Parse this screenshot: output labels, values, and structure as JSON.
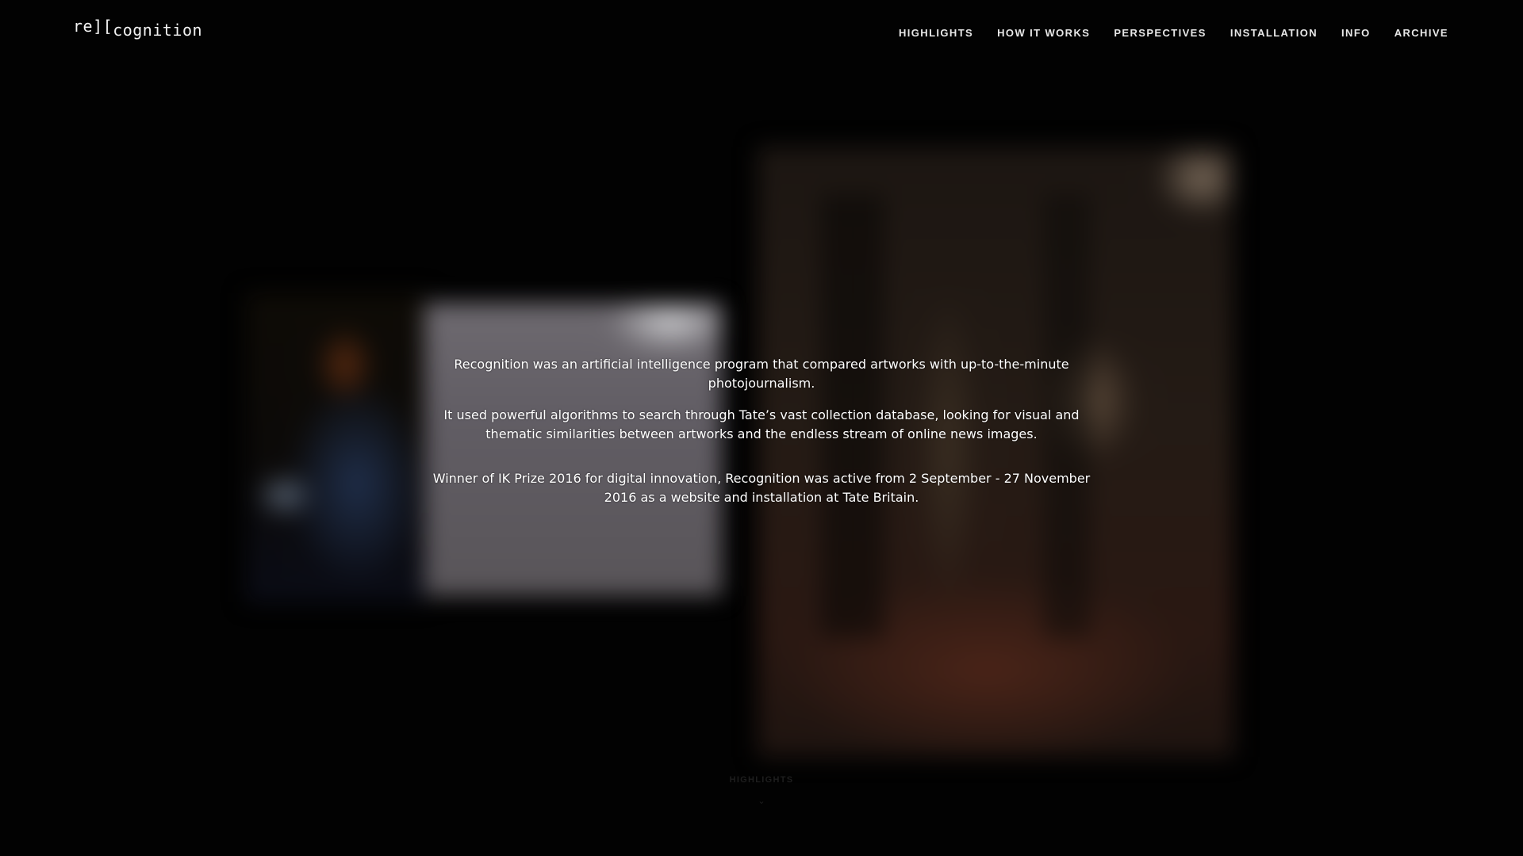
{
  "header": {
    "logo_prefix": "re",
    "logo_bracket": "][",
    "logo_suffix": "cognition",
    "nav": [
      {
        "label": "HIGHLIGHTS"
      },
      {
        "label": "HOW IT WORKS"
      },
      {
        "label": "PERSPECTIVES"
      },
      {
        "label": "INSTALLATION"
      },
      {
        "label": "INFO"
      },
      {
        "label": "ARCHIVE"
      }
    ]
  },
  "intro": {
    "p1": "Recognition was an artificial intelligence program that compared artworks with up-to-the-minute photojournalism.",
    "p2": "It used powerful algorithms to search through Tate’s vast collection database, looking for visual and thematic similarities between artworks and the endless stream of online news images.",
    "p3": "Winner of IK Prize 2016 for digital innovation, Recognition was active from 2 September - 27 November 2016 as a website and installation at Tate Britain."
  },
  "scroll_hint": {
    "label": "HIGHLIGHTS",
    "arrow_icon": "chevron-down-icon",
    "arrow_glyph": "⌄"
  },
  "colors": {
    "background": "#000000",
    "text": "#ffffff"
  }
}
